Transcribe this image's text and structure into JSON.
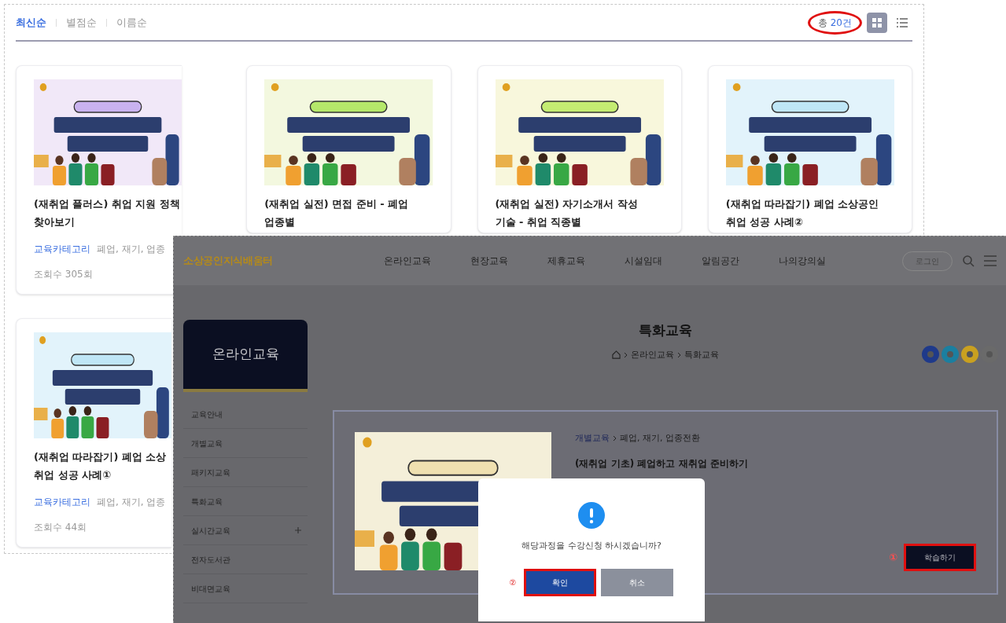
{
  "sort_tabs": [
    {
      "label": "최신순",
      "selected": true
    },
    {
      "label": "별점순",
      "selected": false
    },
    {
      "label": "이름순",
      "selected": false
    }
  ],
  "total": {
    "label": "총",
    "count": "20건",
    "highlighted": true
  },
  "view_modes": [
    {
      "kind": "grid",
      "selected": true
    },
    {
      "kind": "list",
      "selected": false
    }
  ],
  "cards": [
    {
      "title_lines": [
        "(재취업 플러스) 취업 지원 정책",
        "찾아보기"
      ],
      "category": "교육카테고리",
      "tags": "폐업, 재기, 업종",
      "views": "조회수 305회"
    },
    {
      "title_lines": [
        "(재취업 실전) 면접 준비 - 폐업",
        "업종별"
      ]
    },
    {
      "title_lines": [
        "(재취업 실전) 자기소개서 작성",
        "기술 - 취업 직종별"
      ]
    },
    {
      "title_lines": [
        "(재취업 따라잡기) 폐업 소상공인",
        "취업 성공 사례②"
      ]
    },
    {
      "title_lines": [
        "(재취업 따라잡기) 폐업 소상",
        "취업 성공 사례①"
      ],
      "category": "교육카테고리",
      "tags": "폐업, 재기, 업종",
      "views": "조회수 44회"
    }
  ],
  "overlay": {
    "logo": "소상공인지식배움터",
    "nav": [
      "온라인교육",
      "현장교육",
      "제휴교육",
      "시설임대",
      "알림공간",
      "나의강의실"
    ],
    "login": "로그인",
    "page_title": "특화교육",
    "breadcrumb": [
      "온라인교육",
      "특화교육"
    ],
    "sidebar": {
      "title": "온라인교육",
      "items": [
        {
          "label": "교육안내",
          "expandable": false
        },
        {
          "label": "개별교육",
          "expandable": false
        },
        {
          "label": "패키지교육",
          "expandable": false
        },
        {
          "label": "특화교육",
          "expandable": false
        },
        {
          "label": "실시간교육",
          "expandable": true
        },
        {
          "label": "전자도서관",
          "expandable": false
        },
        {
          "label": "비대면교육",
          "expandable": false
        }
      ]
    },
    "course": {
      "category": "개별교육",
      "tags": "폐업, 재기, 업종전환",
      "title": "(재취업 기초) 폐업하고 재취업 준비하기",
      "button": {
        "label": "학습하기",
        "highlighted": true,
        "marker": "①"
      }
    },
    "dialog": {
      "message": "해당과정을 수강신청 하시겠습니까?",
      "buttons": [
        {
          "label": "확인",
          "kind": "primary",
          "highlighted": true,
          "marker": "②"
        },
        {
          "label": "취소",
          "kind": "secondary",
          "highlighted": false
        }
      ]
    }
  }
}
